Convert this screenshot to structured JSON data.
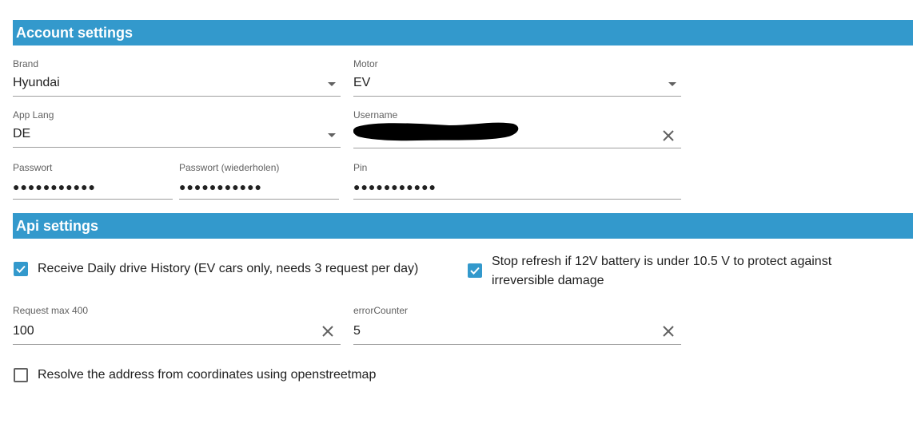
{
  "account_settings": {
    "title": "Account settings",
    "brand": {
      "label": "Brand",
      "value": "Hyundai"
    },
    "motor": {
      "label": "Motor",
      "value": "EV"
    },
    "app_lang": {
      "label": "App Lang",
      "value": "DE"
    },
    "username": {
      "label": "Username"
    },
    "password": {
      "label": "Passwort",
      "value": "●●●●●●●●●●●"
    },
    "password_repeat": {
      "label": "Passwort (wiederholen)",
      "value": "●●●●●●●●●●●"
    },
    "pin": {
      "label": "Pin",
      "value": "●●●●●●●●●●●"
    }
  },
  "api_settings": {
    "title": "Api settings",
    "daily_history": {
      "label": "Receive Daily drive History (EV cars only, needs 3 request per day)",
      "checked": true
    },
    "stop_refresh": {
      "label_line1": "Stop refresh if 12V battery is under 10.5 V to protect against",
      "label_line2": "irreversible damage",
      "checked": true
    },
    "request_max": {
      "label": "Request max 400",
      "value": "100"
    },
    "error_counter": {
      "label": "errorCounter",
      "value": "5"
    },
    "resolve_address": {
      "label": "Resolve the address from coordinates using openstreetmap",
      "checked": false
    }
  },
  "icons": {
    "dropdown": "caret-down-icon",
    "clear": "close-icon",
    "check": "checkmark-icon"
  },
  "colors": {
    "header_bg": "#3399cc",
    "checkbox_checked": "#3399cc"
  }
}
